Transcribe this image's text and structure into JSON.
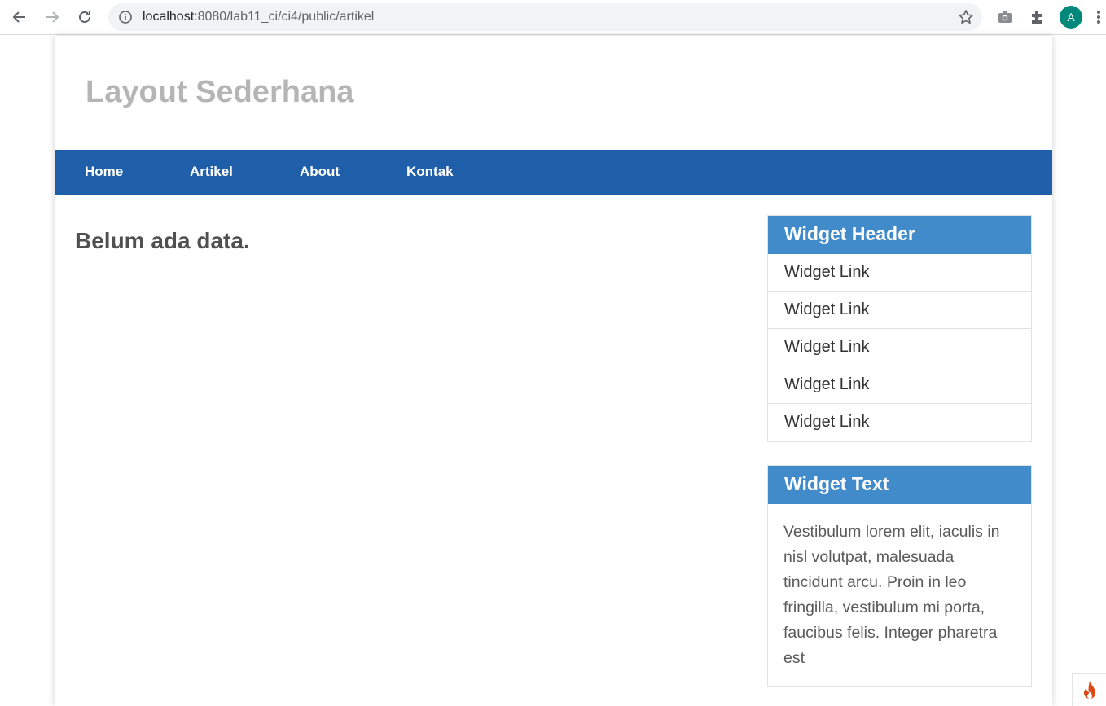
{
  "browser": {
    "url_host": "localhost",
    "url_rest": ":8080/lab11_ci/ci4/public/artikel",
    "avatar_letter": "A",
    "avatar_color": "#00897b"
  },
  "site": {
    "title": "Layout Sederhana",
    "nav": [
      "Home",
      "Artikel",
      "About",
      "Kontak"
    ],
    "nav_color": "#1f5faa"
  },
  "main": {
    "message": "Belum ada data."
  },
  "sidebar": {
    "widget_header": {
      "title": "Widget Header",
      "links": [
        "Widget Link",
        "Widget Link",
        "Widget Link",
        "Widget Link",
        "Widget Link"
      ]
    },
    "widget_text": {
      "title": "Widget Text",
      "body": "Vestibulum lorem elit, iaculis in nisl volutpat, malesuada tincidunt arcu. Proin in leo fringilla, vestibulum mi porta, faucibus felis. Integer pharetra est"
    },
    "header_color": "#428bca"
  },
  "icons": [
    "back-arrow-icon",
    "forward-arrow-icon",
    "reload-icon",
    "info-icon",
    "star-icon",
    "camera-icon",
    "puzzle-extension-icon",
    "more-vertical-icon",
    "codeigniter-flame-icon"
  ]
}
